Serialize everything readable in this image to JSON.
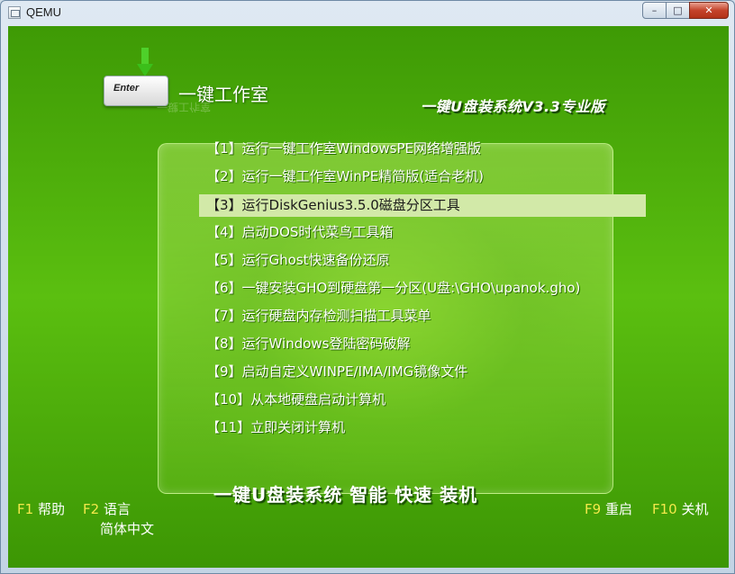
{
  "window": {
    "title": "QEMU",
    "minimize": "–",
    "maximize": "□",
    "close": "✕"
  },
  "logo": {
    "key_label": "Enter",
    "title": "一键工作室",
    "reflection": "一键工作室"
  },
  "brand": "一键U盘装系统V3.3专业版",
  "menu": {
    "items": [
      "【1】运行一键工作室WindowsPE网络增强版",
      "【2】运行一键工作室WinPE精简版(适合老机)",
      "【3】运行DiskGenius3.5.0磁盘分区工具",
      "【4】启动DOS时代菜鸟工具箱",
      "【5】运行Ghost快速备份还原",
      "【6】一键安装GHO到硬盘第一分区(U盘:\\GHO\\upanok.gho)",
      "【7】运行硬盘内存检测扫描工具菜单",
      "【8】运行Windows登陆密码破解",
      "【9】启动自定义WINPE/IMA/IMG镜像文件",
      "【10】从本地硬盘启动计算机",
      "【11】立即关闭计算机"
    ],
    "selected_index": 2
  },
  "slogan": "一键U盘装系统 智能 快速 装机",
  "fkeys": {
    "f1_key": "F1",
    "f1_label": "帮助",
    "f2_key": "F2",
    "f2_label": "语言",
    "f2_sub": "简体中文",
    "f9_key": "F9",
    "f9_label": "重启",
    "f10_key": "F10",
    "f10_label": "关机"
  },
  "colors": {
    "accent": "#5bbf10",
    "highlight": "#d2e9a8",
    "fkey": "#f2e84a"
  }
}
